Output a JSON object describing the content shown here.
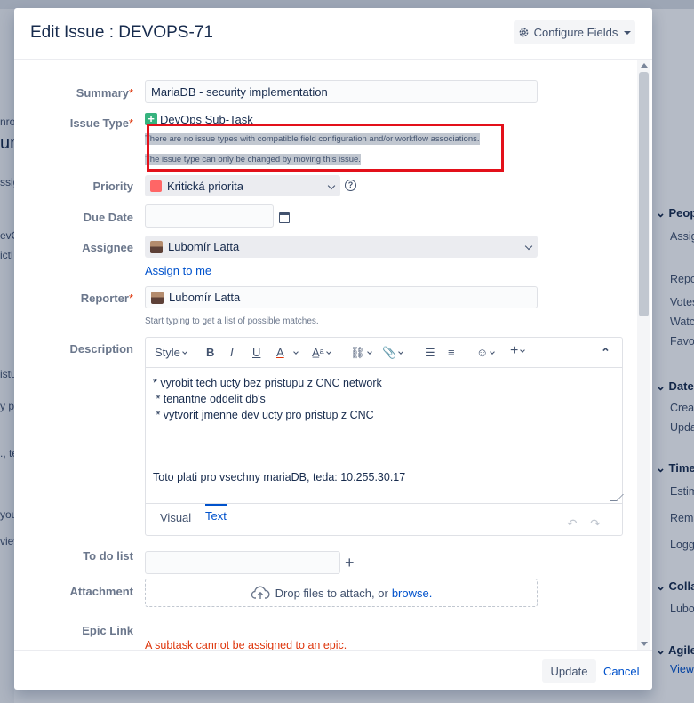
{
  "dialog": {
    "title": "Edit Issue : DEVOPS-71",
    "configure_fields_label": "Configure Fields"
  },
  "form": {
    "summary": {
      "label": "Summary",
      "required_mark": "*",
      "value": "MariaDB - security implementation"
    },
    "issue_type": {
      "label": "Issue Type",
      "required_mark": "*",
      "value": "DevOps Sub-Task",
      "warning_line1": "There are no issue types with compatible field configuration and/or workflow associations.",
      "warning_line2": "The issue type can only be changed by moving this issue."
    },
    "priority": {
      "label": "Priority",
      "value": "Kritická priorita",
      "color": "#ff6666"
    },
    "due_date": {
      "label": "Due Date",
      "value": ""
    },
    "assignee": {
      "label": "Assignee",
      "value": "Lubomír Latta",
      "assign_to_me": "Assign to me"
    },
    "reporter": {
      "label": "Reporter",
      "required_mark": "*",
      "value": "Lubomír Latta",
      "hint": "Start typing to get a list of possible matches."
    },
    "description": {
      "label": "Description",
      "toolbar_style": "Style",
      "lines": [
        "* vyrobit tech ucty bez pristupu z CNC network",
        " * tenantne oddelit db's",
        " * vytvorit jmenne dev ucty pro pristup z CNC",
        "",
        "",
        "Toto plati pro vsechny mariaDB, teda: 10.255.30.17"
      ],
      "tab_visual": "Visual",
      "tab_text": "Text"
    },
    "todo_list": {
      "label": "To do list",
      "value": ""
    },
    "attachment": {
      "label": "Attachment",
      "drop_text": "Drop files to attach, or",
      "browse_link": "browse."
    },
    "epic_link": {
      "label": "Epic Link",
      "error": "A subtask cannot be assigned to an epic."
    }
  },
  "footer": {
    "update_label": "Update",
    "cancel_label": "Cancel"
  },
  "background": {
    "right": {
      "people_head": "Peop",
      "assignee": "Assig",
      "reporter": "Repo",
      "votes": "Votes",
      "watchers": "Watc",
      "favorite": "Favo",
      "dates_head": "Date",
      "created": "Creat",
      "updated": "Upda",
      "time_head": "Time",
      "estimated": "Estim",
      "remaining": "Rema",
      "logged": "Logg",
      "collab_head": "Colla",
      "collab_user": "Lubo",
      "agile_head": "Agile",
      "view": "View"
    },
    "left": [
      "nro",
      "ur",
      "ssig",
      "evO",
      "ictl",
      "istu",
      "y pr",
      "., te",
      "you",
      "view"
    ]
  },
  "colors": {
    "accent": "#0052cc",
    "error": "#de350b",
    "highlight_box": "#e3101a"
  }
}
